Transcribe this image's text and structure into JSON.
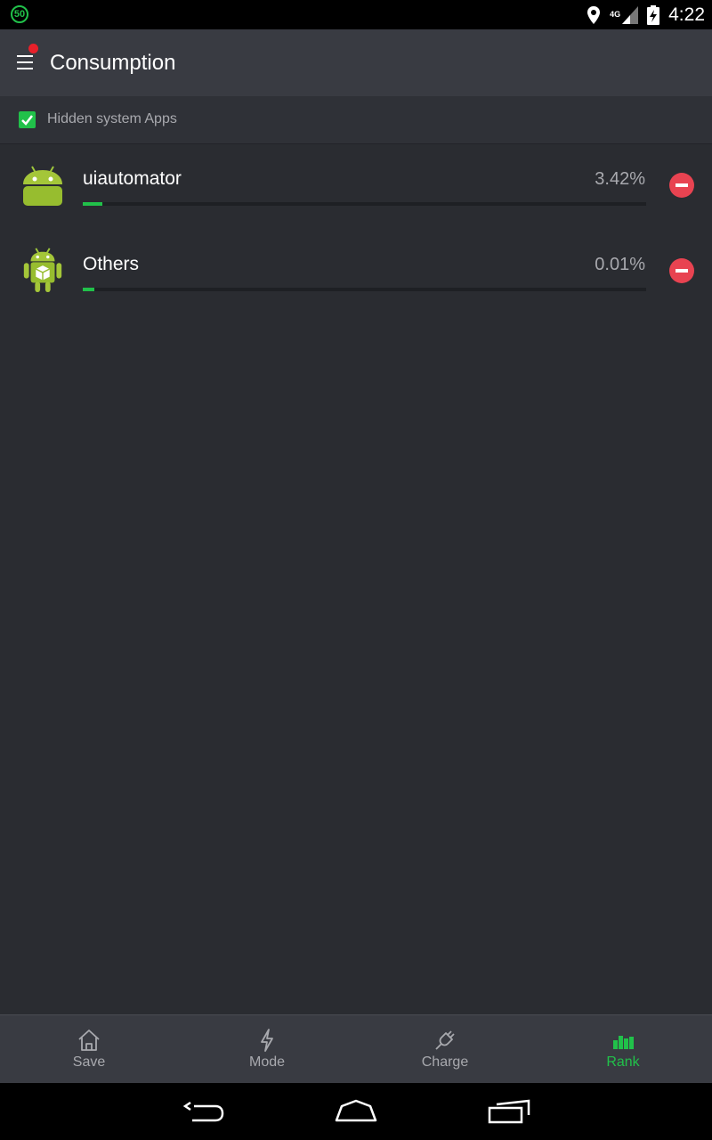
{
  "status_bar": {
    "badge": "50",
    "network": "4G",
    "time": "4:22"
  },
  "app_bar": {
    "title": "Consumption"
  },
  "filter": {
    "label": "Hidden system Apps",
    "checked": true
  },
  "apps": [
    {
      "name": "uiautomator",
      "percent": "3.42%",
      "usage": 0.0342
    },
    {
      "name": "Others",
      "percent": "0.01%",
      "usage": 0.0001
    }
  ],
  "bottom_nav": {
    "tabs": [
      {
        "label": "Save",
        "icon": "home-icon"
      },
      {
        "label": "Mode",
        "icon": "lightning-icon"
      },
      {
        "label": "Charge",
        "icon": "plug-icon"
      },
      {
        "label": "Rank",
        "icon": "bar-chart-icon",
        "active": true
      }
    ]
  },
  "colors": {
    "accent": "#21c14a",
    "background": "#2a2c31",
    "app_bar": "#393b42",
    "remove": "#e84351"
  }
}
